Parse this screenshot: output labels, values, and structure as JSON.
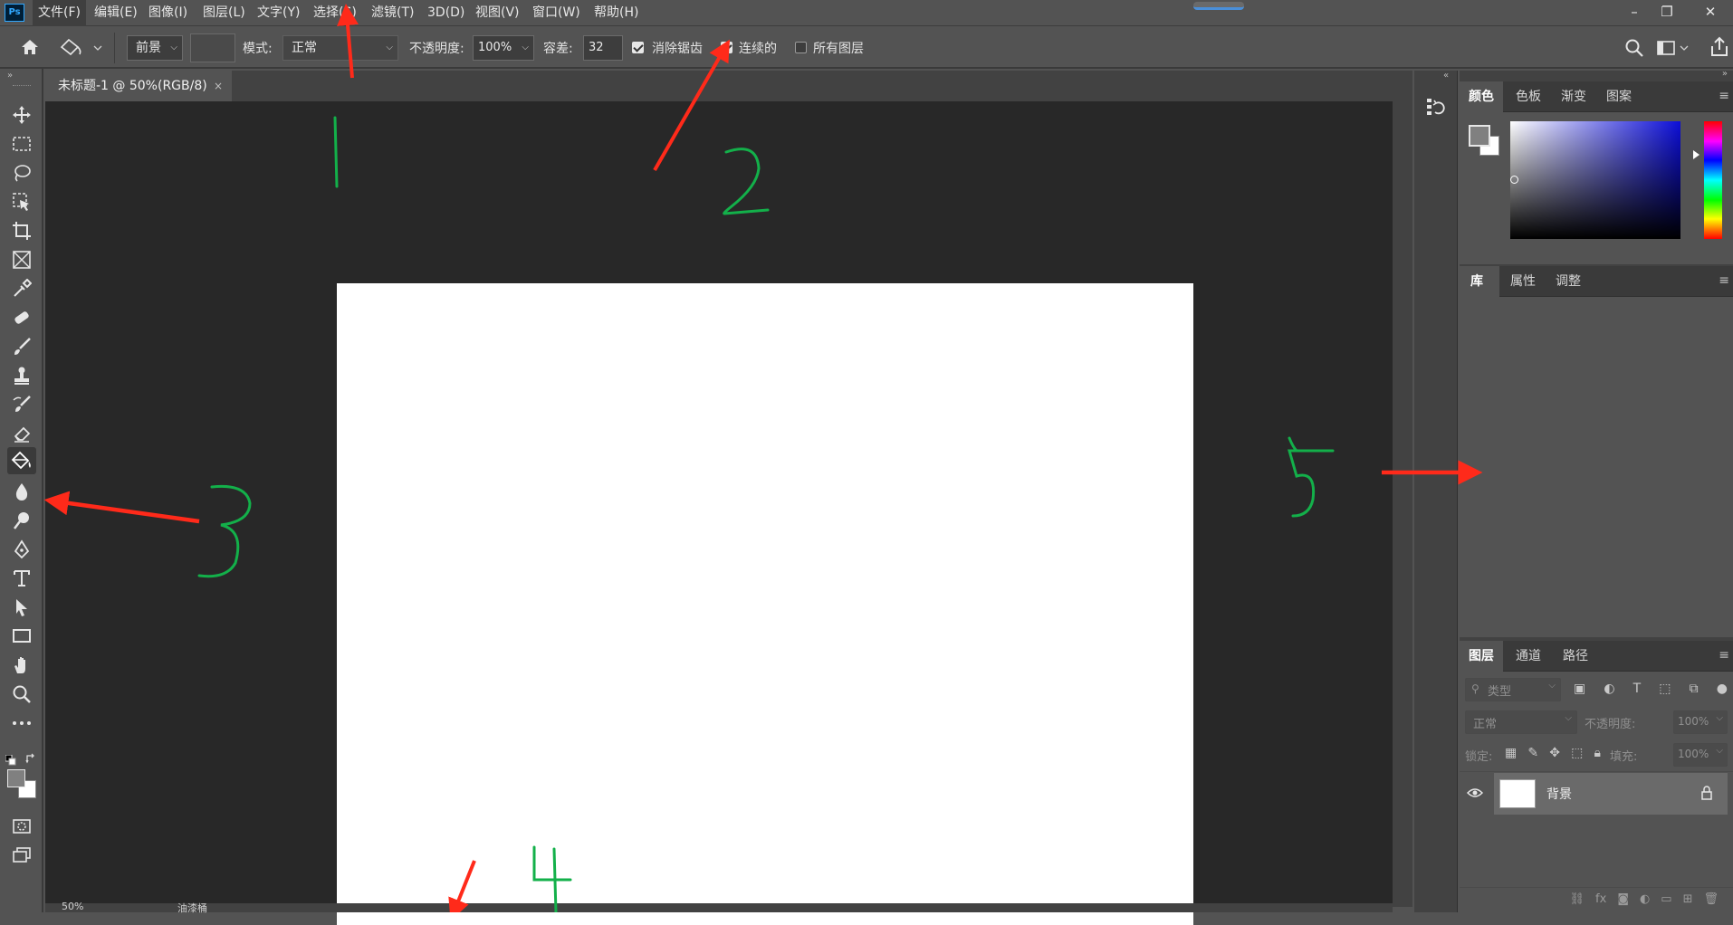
{
  "app": {
    "logo_text": "Ps"
  },
  "menu": [
    "文件(F)",
    "编辑(E)",
    "图像(I)",
    "图层(L)",
    "文字(Y)",
    "选择(S)",
    "滤镜(T)",
    "3D(D)",
    "视图(V)",
    "窗口(W)",
    "帮助(H)"
  ],
  "window_controls": {
    "minimize": "–",
    "restore": "❐",
    "close": "✕"
  },
  "options": {
    "fill_source": "前景",
    "mode_label": "模式:",
    "mode_value": "正常",
    "opacity_label": "不透明度:",
    "opacity_value": "100%",
    "tolerance_label": "容差:",
    "tolerance_value": "32",
    "antialias_label": "消除锯齿",
    "antialias_checked": true,
    "contiguous_label": "连续的",
    "contiguous_checked": true,
    "all_layers_label": "所有图层",
    "all_layers_checked": false
  },
  "document": {
    "tab_title": "未标题-1 @ 50%(RGB/8)",
    "close_glyph": "×",
    "zoom": "50%",
    "status": "油漆桶"
  },
  "panels": {
    "color_group": {
      "tabs": [
        "颜色",
        "色板",
        "渐变",
        "图案"
      ],
      "active": 0
    },
    "library_group": {
      "tabs": [
        "库",
        "属性",
        "调整"
      ],
      "active": 0
    },
    "layers_group": {
      "tabs": [
        "图层",
        "通道",
        "路径"
      ],
      "active": 0
    },
    "layers": {
      "filter_placeholder": "类型",
      "blend_mode": "正常",
      "opacity_label": "不透明度:",
      "opacity_value": "100%",
      "lock_label": "锁定:",
      "fill_label": "填充:",
      "fill_value": "100%",
      "items": [
        {
          "name": "背景",
          "locked": true,
          "visible": true
        }
      ]
    }
  },
  "annotations": {
    "numbers": [
      "1",
      "2",
      "3",
      "4",
      "5"
    ],
    "arrow_color": "#ff2a1a",
    "number_color": "#13b04a"
  },
  "colors": {
    "ui_bg": "#535353",
    "panel_bg": "#424242",
    "doc_bg": "#282828",
    "canvas": "#ffffff",
    "accent": "#31a8ff"
  }
}
